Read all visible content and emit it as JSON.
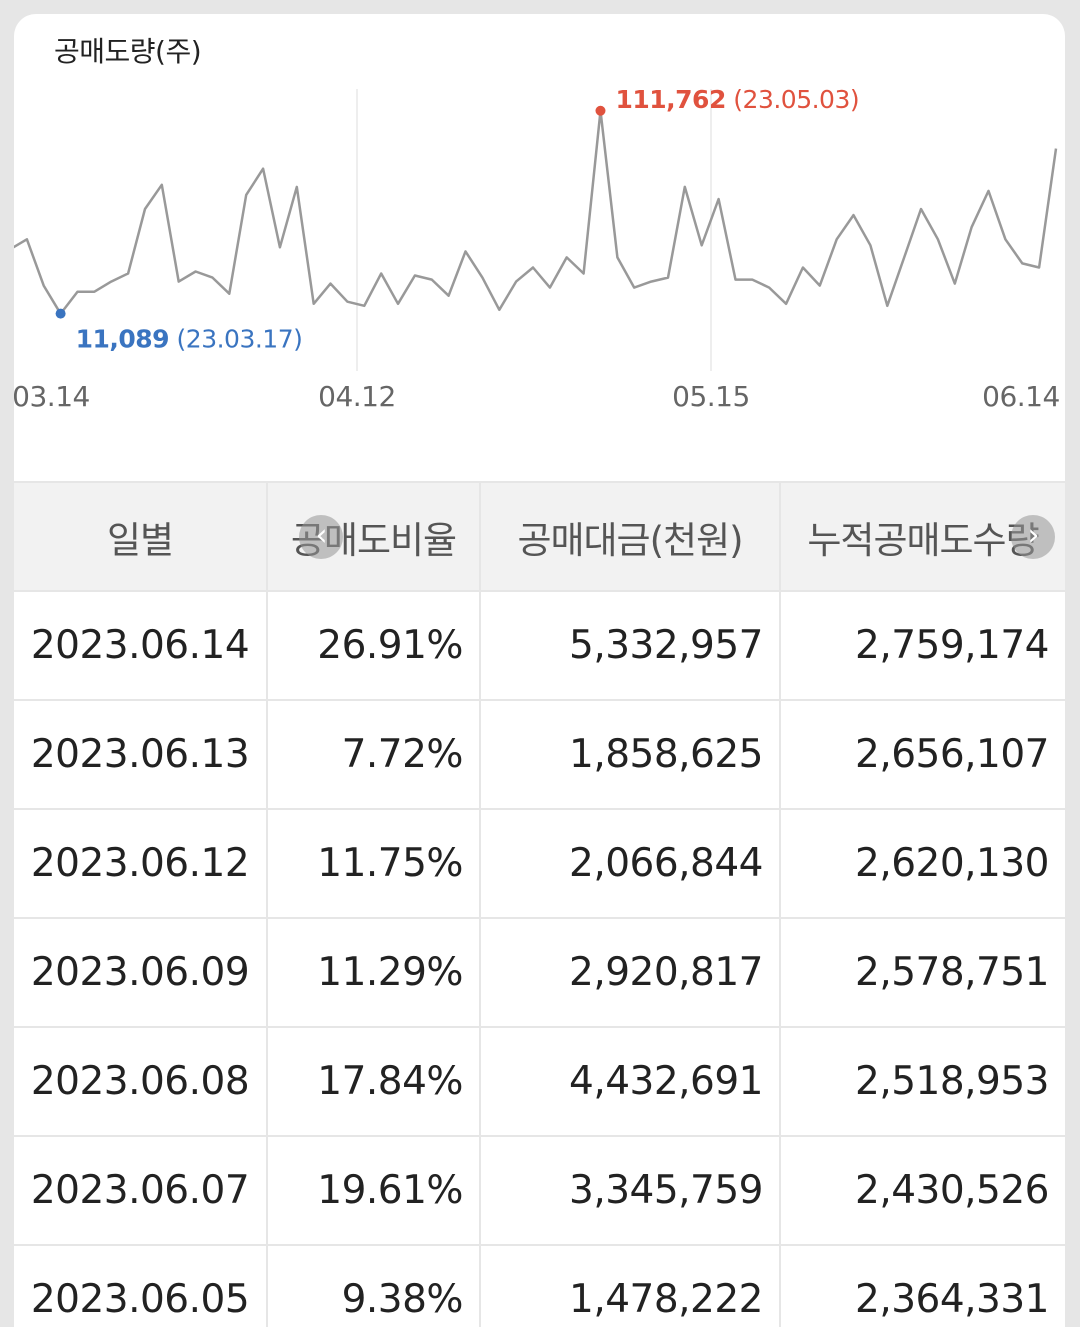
{
  "chart": {
    "title": "공매도량(주)",
    "line_color": "#999999",
    "max_color": "#e0523e",
    "min_color": "#3a74c0",
    "max_marker": {
      "value": "111,762",
      "date": "(23.05.03)"
    },
    "min_marker": {
      "value": "11,089",
      "date": "(23.03.17)"
    }
  },
  "chart_data": {
    "type": "line",
    "title": "공매도량(주)",
    "x_ticks": [
      "03.14",
      "04.12",
      "05.15",
      "06.14"
    ],
    "ylim": [
      0,
      130000
    ],
    "series": [
      {
        "values": [
          43000,
          48000,
          25000,
          11089,
          22000,
          22000,
          27000,
          31000,
          63000,
          75000,
          27000,
          32000,
          29000,
          21000,
          70000,
          83000,
          44000,
          74000,
          16000,
          26000,
          17000,
          15000,
          31000,
          16000,
          30000,
          28000,
          20000,
          42000,
          29000,
          13000,
          27000,
          34000,
          24000,
          39000,
          31000,
          111762,
          39000,
          24000,
          27000,
          29000,
          74000,
          45000,
          68000,
          28000,
          28000,
          24000,
          16000,
          34000,
          25000,
          48000,
          60000,
          45000,
          15000,
          39000,
          63000,
          48000,
          26000,
          54000,
          72000,
          48000,
          36000,
          34000,
          93000
        ]
      }
    ],
    "max": {
      "value": 111762,
      "date": "23.05.03"
    },
    "min": {
      "value": 11089,
      "date": "23.03.17"
    }
  },
  "nav": {
    "left_icon": "chevron-left-icon",
    "right_icon": "chevron-right-icon"
  },
  "table": {
    "headers": [
      "일별",
      "공매도비율",
      "공매대금(천원)",
      "누적공매도수량"
    ],
    "rows": [
      [
        "2023.06.14",
        "26.91%",
        "5,332,957",
        "2,759,174"
      ],
      [
        "2023.06.13",
        "7.72%",
        "1,858,625",
        "2,656,107"
      ],
      [
        "2023.06.12",
        "11.75%",
        "2,066,844",
        "2,620,130"
      ],
      [
        "2023.06.09",
        "11.29%",
        "2,920,817",
        "2,578,751"
      ],
      [
        "2023.06.08",
        "17.84%",
        "4,432,691",
        "2,518,953"
      ],
      [
        "2023.06.07",
        "19.61%",
        "3,345,759",
        "2,430,526"
      ],
      [
        "2023.06.05",
        "9.38%",
        "1,478,222",
        "2,364,331"
      ]
    ]
  }
}
